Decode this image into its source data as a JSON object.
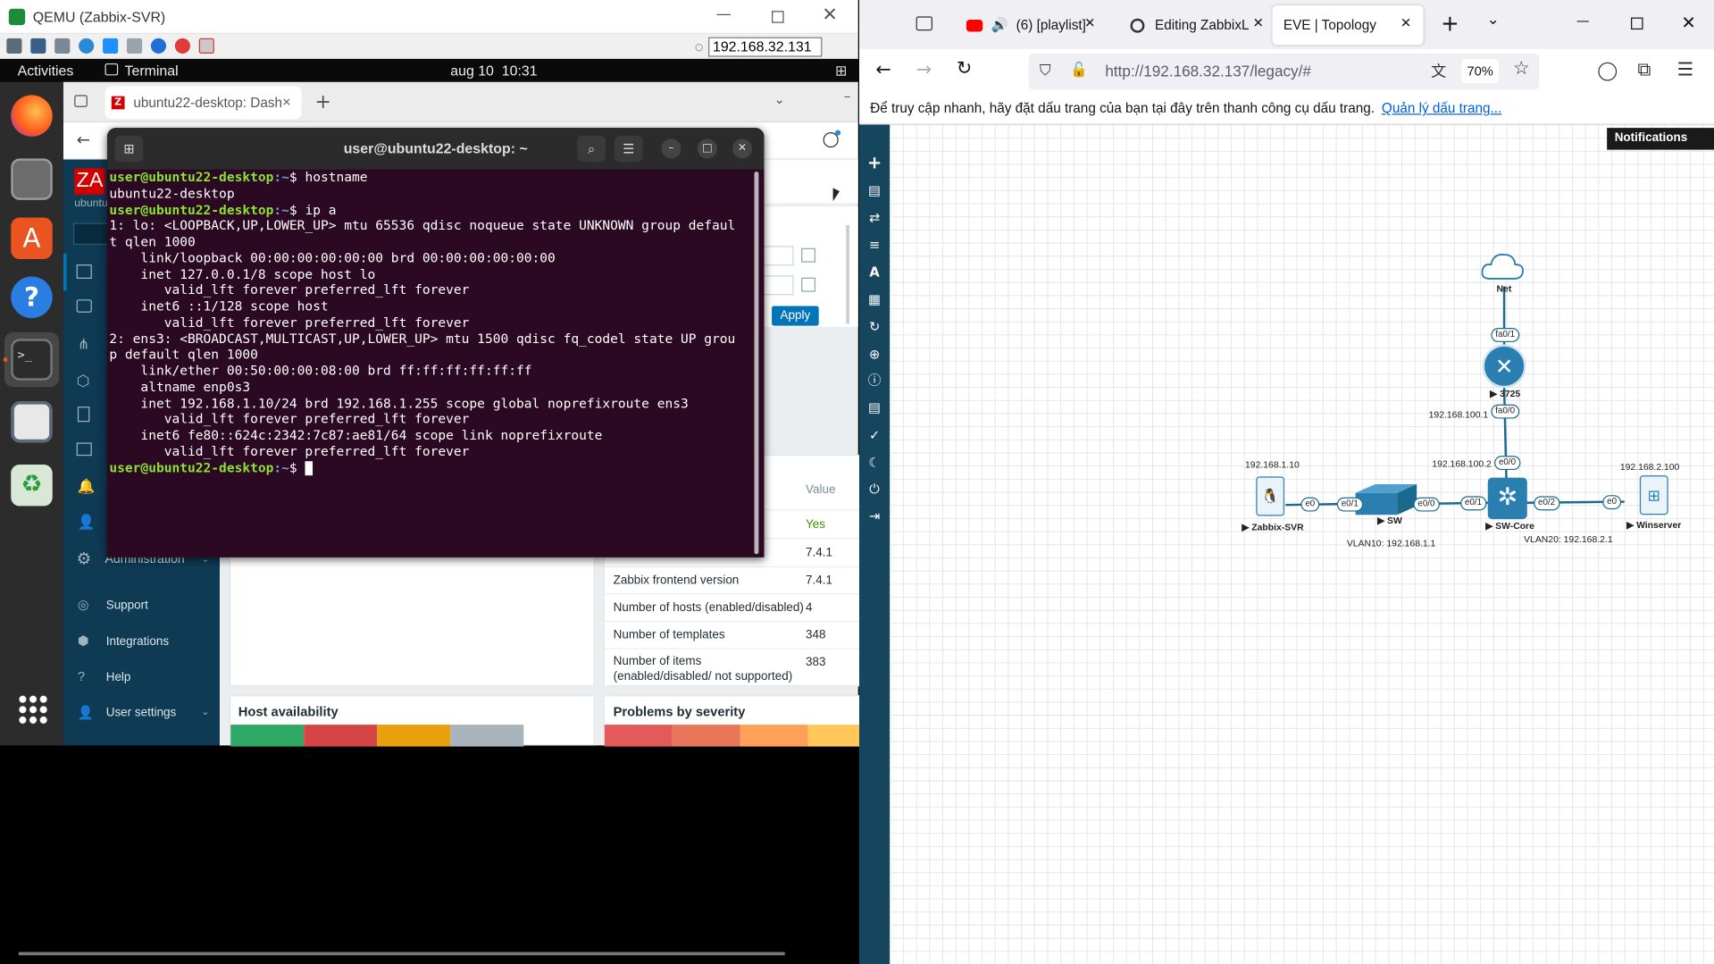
{
  "qemu": {
    "title": "QEMU (Zabbix-SVR)",
    "vnc_address": "192.168.32.131"
  },
  "gnome": {
    "activities": "Activities",
    "app": "Terminal",
    "clock": "aug 10  10:31"
  },
  "vm_browser": {
    "tab_title": "ubuntu22-desktop: Dash"
  },
  "zabbix": {
    "logo": "ZA",
    "host": "ubuntu",
    "menu": [
      {
        "label": "Administration"
      },
      {
        "label": "Support"
      },
      {
        "label": "Integrations"
      },
      {
        "label": "Help"
      },
      {
        "label": "User settings"
      }
    ],
    "apply": "Apply",
    "info_header_value": "Value",
    "info_rows": [
      {
        "label": "",
        "value": "Yes"
      },
      {
        "label": "",
        "value": "7.4.1"
      },
      {
        "label": "Zabbix frontend version",
        "value": "7.4.1"
      },
      {
        "label": "Number of hosts (enabled/disabled)",
        "value": "4"
      },
      {
        "label": "Number of templates",
        "value": "348"
      },
      {
        "label": "Number of items (enabled/disabled/ not supported)",
        "value": "383"
      }
    ],
    "host_availability": "Host availability",
    "problems_by_severity": "Problems by severity"
  },
  "terminal": {
    "title": "user@ubuntu22-desktop: ~",
    "prompt_user": "user@ubuntu22-desktop",
    "prompt_path": ":~",
    "prompt_sign": "$ ",
    "cmd1": "hostname",
    "out1": "ubuntu22-desktop",
    "cmd2": "ip a",
    "out2": "1: lo: <LOOPBACK,UP,LOWER_UP> mtu 65536 qdisc noqueue state UNKNOWN group defaul\nt qlen 1000\n    link/loopback 00:00:00:00:00:00 brd 00:00:00:00:00:00\n    inet 127.0.0.1/8 scope host lo\n       valid_lft forever preferred_lft forever\n    inet6 ::1/128 scope host\n       valid_lft forever preferred_lft forever\n2: ens3: <BROADCAST,MULTICAST,UP,LOWER_UP> mtu 1500 qdisc fq_codel state UP grou\np default qlen 1000\n    link/ether 00:50:00:00:08:00 brd ff:ff:ff:ff:ff:ff\n    altname enp0s3\n    inet 192.168.1.10/24 brd 192.168.1.255 scope global noprefixroute ens3\n       valid_lft forever preferred_lft forever\n    inet6 fe80::624c:2342:7c87:ae81/64 scope link noprefixroute\n       valid_lft forever preferred_lft forever"
  },
  "firefox": {
    "tabs": [
      {
        "label": "(6) [playlist]"
      },
      {
        "label": "Editing ZabbixL"
      },
      {
        "label": "EVE | Topology"
      }
    ],
    "url": "http://192.168.32.137/legacy/#",
    "zoom": "70%",
    "bookmark_bar_text": "Để truy cập nhanh, hãy đặt dấu trang của bạn tại đây trên thanh công cụ dấu trang.",
    "bookmark_link": "Quản lý dấu trang..."
  },
  "eve": {
    "notifications": "Notifications",
    "nodes": {
      "net": "Net",
      "router": "3725",
      "zabbix": "Zabbix-SVR",
      "sw": "SW",
      "swcore": "SW-Core",
      "winserver": "Winserver"
    },
    "labels": {
      "ip_zabbix": "192.168.1.10",
      "ip_r": "192.168.100.1",
      "ip_core": "192.168.100.2",
      "ip_win": "192.168.2.100",
      "vlan10": "VLAN10: 192.168.1.1",
      "vlan20": "VLAN20: 192.168.2.1"
    },
    "ports": {
      "fa01": "fa0/1",
      "fa00": "fa0/0",
      "e00": "e0/0",
      "e0a": "e0",
      "e01a": "e0/1",
      "e00b": "e0/0",
      "e01b": "e0/1",
      "e02": "e0/2",
      "e0b": "e0"
    }
  }
}
